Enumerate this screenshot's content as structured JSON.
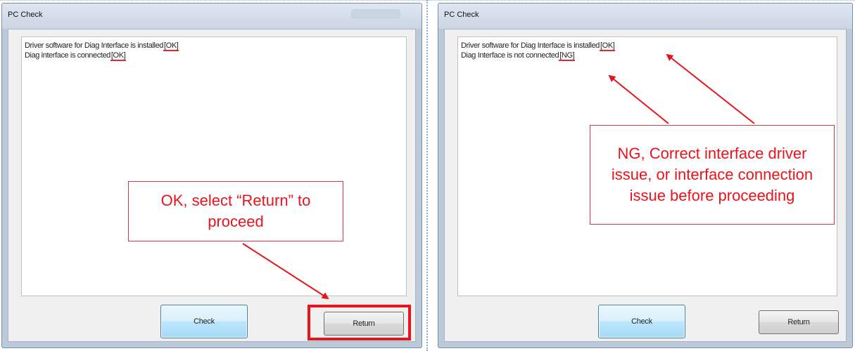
{
  "left_window": {
    "title": "PC Check",
    "line1_text": "Driver software for Diag Interface  is installed",
    "line1_status": "[OK]",
    "line2_text": "Diag interface  is  connected",
    "line2_status": "[OK]",
    "check_label": "Check",
    "return_label": "Return"
  },
  "right_window": {
    "title": "PC Check",
    "line1_text": "Driver software for Diag Interface  is installed",
    "line1_status": "[OK]",
    "line2_text": "Diag Interface  is not connected",
    "line2_status": "[NG]",
    "check_label": "Check",
    "return_label": "Return"
  },
  "annotations": {
    "left_callout": "OK, select “Return” to proceed",
    "right_callout": "NG, Correct interface driver issue, or interface connection issue before proceeding",
    "accent_color": "#e8141c"
  }
}
